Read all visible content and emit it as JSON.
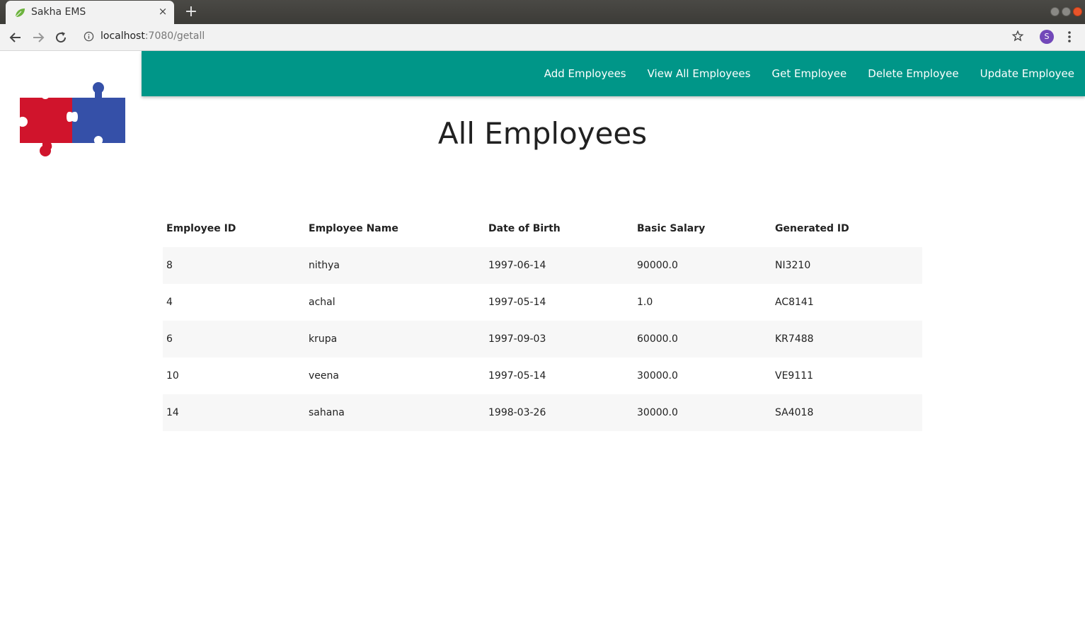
{
  "browser": {
    "tab_title": "Sakha EMS",
    "tab_close": "×",
    "new_tab": "+",
    "url_host": "localhost",
    "url_path": ":7080/getall",
    "profile_initial": "S"
  },
  "nav": {
    "links": [
      "Add Employees",
      "View All Employees",
      "Get Employee",
      "Delete Employee",
      "Update Employee"
    ]
  },
  "page": {
    "title": "All Employees"
  },
  "table": {
    "headers": [
      "Employee ID",
      "Employee Name",
      "Date of Birth",
      "Basic Salary",
      "Generated ID"
    ],
    "rows": [
      [
        "8",
        "nithya",
        "1997-06-14",
        "90000.0",
        "NI3210"
      ],
      [
        "4",
        "achal",
        "1997-05-14",
        "1.0",
        "AC8141"
      ],
      [
        "6",
        "krupa",
        "1997-09-03",
        "60000.0",
        "KR7488"
      ],
      [
        "10",
        "veena",
        "1997-05-14",
        "30000.0",
        "VE9111"
      ],
      [
        "14",
        "sahana",
        "1998-03-26",
        "30000.0",
        "SA4018"
      ]
    ]
  },
  "colors": {
    "navbar": "#009688",
    "logo_red": "#d0142c",
    "logo_blue": "#3550a8"
  }
}
